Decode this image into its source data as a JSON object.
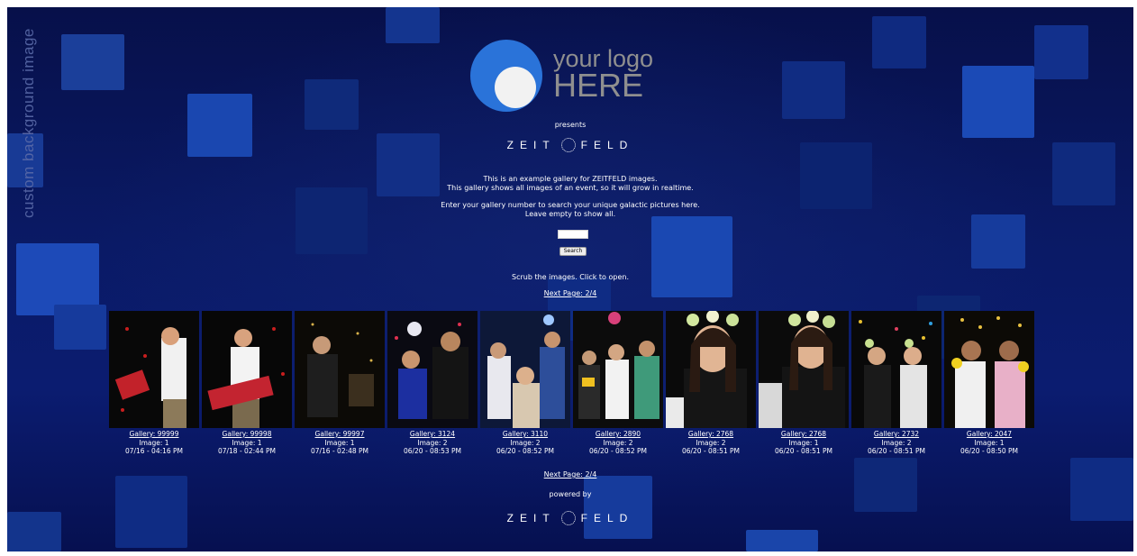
{
  "side_label": "custom background image",
  "logo": {
    "line1": "your logo",
    "line2": "HERE"
  },
  "presents": "presents",
  "brand_top": {
    "left": "ZEIT",
    "right": "FELD"
  },
  "intro": {
    "line1": "This is an example gallery for ZEITFELD images.",
    "line2": "This gallery shows all images of an event, so it will grow in realtime.",
    "line3": "Enter your gallery number to search your unique galactic pictures here.",
    "line4": "Leave empty to show all."
  },
  "search": {
    "value": "",
    "button_label": "Search"
  },
  "scrub_hint": "Scrub the images. Click to open.",
  "next_page_top": "Next Page: 2/4",
  "next_page_bottom": "Next Page: 2/4",
  "powered_by": "powered by",
  "brand_bottom": {
    "left": "ZEIT",
    "right": "FELD"
  },
  "colors": {
    "logo_blue": "#2a73d9",
    "logo_text": "#8f8f8f",
    "background": "#0a1a66"
  },
  "gallery": [
    {
      "gallery": "Gallery: 99999",
      "image": "Image: 1",
      "date": "07/16 - 04:16 PM"
    },
    {
      "gallery": "Gallery: 99998",
      "image": "Image: 1",
      "date": "07/18 - 02:44 PM"
    },
    {
      "gallery": "Gallery: 99997",
      "image": "Image: 1",
      "date": "07/16 - 02:48 PM"
    },
    {
      "gallery": "Gallery: 3124",
      "image": "Image: 2",
      "date": "06/20 - 08:53 PM"
    },
    {
      "gallery": "Gallery: 3110",
      "image": "Image: 2",
      "date": "06/20 - 08:52 PM"
    },
    {
      "gallery": "Gallery: 2890",
      "image": "Image: 2",
      "date": "06/20 - 08:52 PM"
    },
    {
      "gallery": "Gallery: 2768",
      "image": "Image: 2",
      "date": "06/20 - 08:51 PM"
    },
    {
      "gallery": "Gallery: 2768",
      "image": "Image: 1",
      "date": "06/20 - 08:51 PM"
    },
    {
      "gallery": "Gallery: 2732",
      "image": "Image: 2",
      "date": "06/20 - 08:51 PM"
    },
    {
      "gallery": "Gallery: 2047",
      "image": "Image: 1",
      "date": "06/20 - 08:50 PM"
    }
  ]
}
